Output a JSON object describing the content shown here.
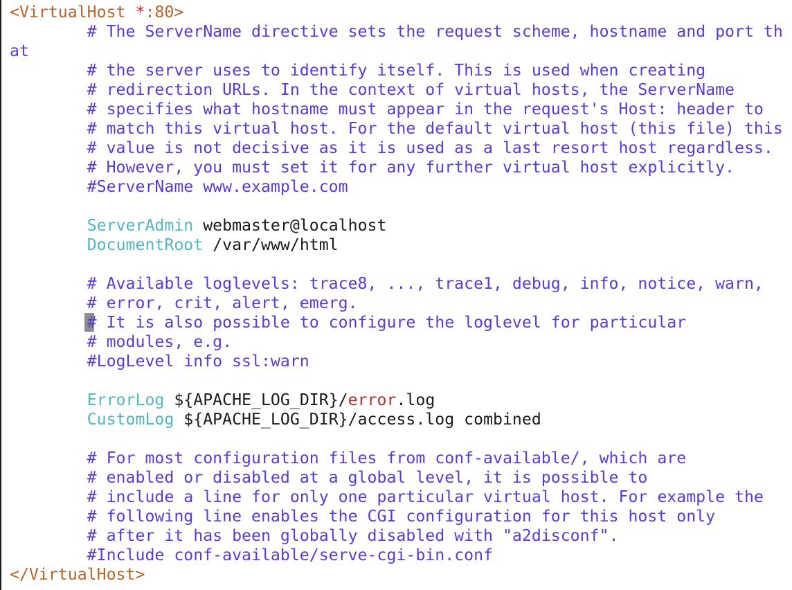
{
  "window": {
    "title": ""
  },
  "editor": {
    "lines": [
      {
        "tokens": [
          {
            "t": "tag",
            "s": "<VirtualHost "
          },
          {
            "t": "keyword",
            "s": "*"
          },
          {
            "t": "tag",
            "s": ":80>"
          }
        ]
      },
      {
        "tokens": [
          {
            "t": "comment",
            "s": "        # The ServerName directive sets the request scheme, hostname and port th"
          }
        ]
      },
      {
        "tokens": [
          {
            "t": "comment",
            "s": "at"
          }
        ]
      },
      {
        "tokens": [
          {
            "t": "comment",
            "s": "        # the server uses to identify itself. This is used when creating"
          }
        ]
      },
      {
        "tokens": [
          {
            "t": "comment",
            "s": "        # redirection URLs. In the context of virtual hosts, the ServerName"
          }
        ]
      },
      {
        "tokens": [
          {
            "t": "comment",
            "s": "        # specifies what hostname must appear in the request's Host: header to"
          }
        ]
      },
      {
        "tokens": [
          {
            "t": "comment",
            "s": "        # match this virtual host. For the default virtual host (this file) this"
          }
        ]
      },
      {
        "tokens": [
          {
            "t": "comment",
            "s": "        # value is not decisive as it is used as a last resort host regardless."
          }
        ]
      },
      {
        "tokens": [
          {
            "t": "comment",
            "s": "        # However, you must set it for any further virtual host explicitly."
          }
        ]
      },
      {
        "tokens": [
          {
            "t": "comment",
            "s": "        #ServerName www.example.com"
          }
        ]
      },
      {
        "tokens": []
      },
      {
        "tokens": [
          {
            "t": "plain",
            "s": "        "
          },
          {
            "t": "directive",
            "s": "ServerAdmin"
          },
          {
            "t": "value",
            "s": " webmaster@localhost"
          }
        ]
      },
      {
        "tokens": [
          {
            "t": "plain",
            "s": "        "
          },
          {
            "t": "directive",
            "s": "DocumentRoot"
          },
          {
            "t": "value",
            "s": " /var/www/html"
          }
        ]
      },
      {
        "tokens": []
      },
      {
        "tokens": [
          {
            "t": "comment",
            "s": "        # Available loglevels: trace8, ..., trace1, debug, info, notice, warn,"
          }
        ]
      },
      {
        "tokens": [
          {
            "t": "comment",
            "s": "        # error, crit, alert, emerg."
          }
        ]
      },
      {
        "tokens": [
          {
            "t": "comment",
            "s": "        # It is also possible to configure the loglevel for particular"
          }
        ]
      },
      {
        "tokens": [
          {
            "t": "comment",
            "s": "        # modules, e.g."
          }
        ]
      },
      {
        "tokens": [
          {
            "t": "comment",
            "s": "        #LogLevel info ssl:warn"
          }
        ]
      },
      {
        "tokens": []
      },
      {
        "tokens": [
          {
            "t": "plain",
            "s": "        "
          },
          {
            "t": "directive",
            "s": "ErrorLog"
          },
          {
            "t": "value",
            "s": " ${APACHE_LOG_DIR}/"
          },
          {
            "t": "keyword",
            "s": "error"
          },
          {
            "t": "value",
            "s": ".log"
          }
        ]
      },
      {
        "tokens": [
          {
            "t": "plain",
            "s": "        "
          },
          {
            "t": "directive",
            "s": "CustomLog"
          },
          {
            "t": "value",
            "s": " ${APACHE_LOG_DIR}/access.log combined"
          }
        ]
      },
      {
        "tokens": []
      },
      {
        "tokens": [
          {
            "t": "comment",
            "s": "        # For most configuration files from conf-available/, which are"
          }
        ]
      },
      {
        "tokens": [
          {
            "t": "comment",
            "s": "        # enabled or disabled at a global level, it is possible to"
          }
        ]
      },
      {
        "tokens": [
          {
            "t": "comment",
            "s": "        # include a line for only one particular virtual host. For example the"
          }
        ]
      },
      {
        "tokens": [
          {
            "t": "comment",
            "s": "        # following line enables the CGI configuration for this host only"
          }
        ]
      },
      {
        "tokens": [
          {
            "t": "comment",
            "s": "        # after it has been globally disabled with \"a2disconf\"."
          }
        ]
      },
      {
        "tokens": [
          {
            "t": "comment",
            "s": "        #Include conf-available/serve-cgi-bin.conf"
          }
        ]
      },
      {
        "tokens": [
          {
            "t": "tag",
            "s": "</VirtualHost>"
          }
        ]
      }
    ],
    "cursor": {
      "line": 16,
      "column": 8
    }
  },
  "colors": {
    "tag": "#b8652a",
    "comment": "#5a3bd6",
    "directive": "#52b5c4",
    "value": "#1a1a1a",
    "keyword": "#b8302a",
    "cursor": "#8e8e8e",
    "background": "#ffffff"
  }
}
